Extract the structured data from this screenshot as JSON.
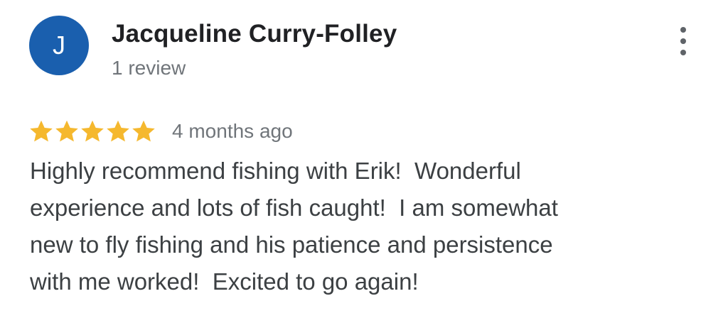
{
  "review": {
    "author": {
      "initial": "J",
      "name": "Jacqueline Curry-Folley",
      "review_count": "1 review",
      "avatar_color": "#1a5fae"
    },
    "rating": 5,
    "rating_max": 5,
    "star_color": "#f5b82e",
    "time_ago": "4 months ago",
    "text_lines": [
      "Highly recommend fishing with Erik!  Wonderful",
      "experience and lots of fish caught!  I am somewhat",
      "new to fly fishing and his patience and persistence",
      "with me worked!  Excited to go again!"
    ],
    "menu_icon": "more-vert-icon"
  }
}
